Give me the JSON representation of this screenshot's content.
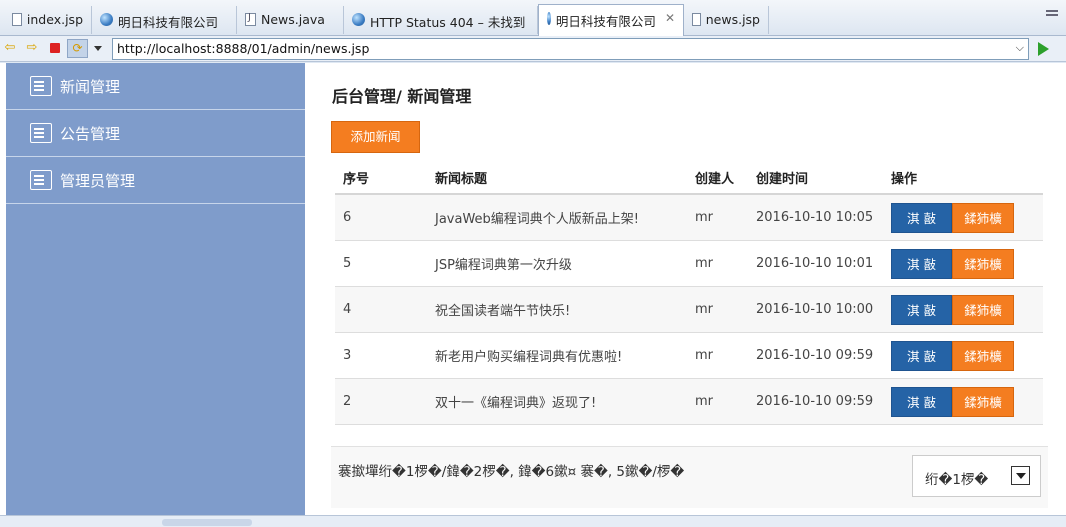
{
  "browser": {
    "tabs": [
      {
        "label": "index.jsp",
        "icon": "doc-icon"
      },
      {
        "label": "明日科技有限公司",
        "icon": "globe-icon"
      },
      {
        "label": "News.java",
        "icon": "java-file-icon"
      },
      {
        "label": "HTTP Status 404 – 未找到",
        "icon": "globe-icon"
      },
      {
        "label": "明日科技有限公司",
        "icon": "globe-icon",
        "active": true
      },
      {
        "label": "news.jsp",
        "icon": "doc-icon"
      }
    ],
    "url": "http://localhost:8888/01/admin/news.jsp"
  },
  "sidebar": {
    "items": [
      {
        "label": "新闻管理",
        "icon": "edit-doc-icon"
      },
      {
        "label": "公告管理",
        "icon": "search-doc-icon"
      },
      {
        "label": "管理员管理",
        "icon": "id-card-icon"
      }
    ]
  },
  "main": {
    "title": "后台管理/ 新闻管理",
    "add_button": "添加新闻",
    "columns": [
      "序号",
      "新闻标题",
      "创建人",
      "创建时间",
      "操作"
    ],
    "rows": [
      {
        "id": "6",
        "title": "JavaWeb编程词典个人版新品上架!",
        "creator": "mr",
        "time": "2016-10-10 10:05",
        "edit": "淇  敼",
        "delete": "鍒犻櫎"
      },
      {
        "id": "5",
        "title": "JSP编程词典第一次升级",
        "creator": "mr",
        "time": "2016-10-10 10:01",
        "edit": "淇  敼",
        "delete": "鍒犻櫎"
      },
      {
        "id": "4",
        "title": "祝全国读者端午节快乐!",
        "creator": "mr",
        "time": "2016-10-10 10:00",
        "edit": "淇  敼",
        "delete": "鍒犻櫎"
      },
      {
        "id": "3",
        "title": "新老用户购买编程词典有优惠啦!",
        "creator": "mr",
        "time": "2016-10-10 09:59",
        "edit": "淇  敼",
        "delete": "鍒犻櫎"
      },
      {
        "id": "2",
        "title": "双十一《编程词典》返现了!",
        "creator": "mr",
        "time": "2016-10-10 09:59",
        "edit": "淇  敼",
        "delete": "鍒犻櫎"
      }
    ],
    "pager_text": "褰撳墠绗�1椤�/鍏�2椤�,    鍏�6鏉¤    褰�,    5鏉�/椤�",
    "pager_select": "绗�1椤�"
  },
  "colors": {
    "sidebar_bg": "#7f9ccb",
    "accent_orange": "#f47d20",
    "accent_blue": "#2563a6"
  }
}
